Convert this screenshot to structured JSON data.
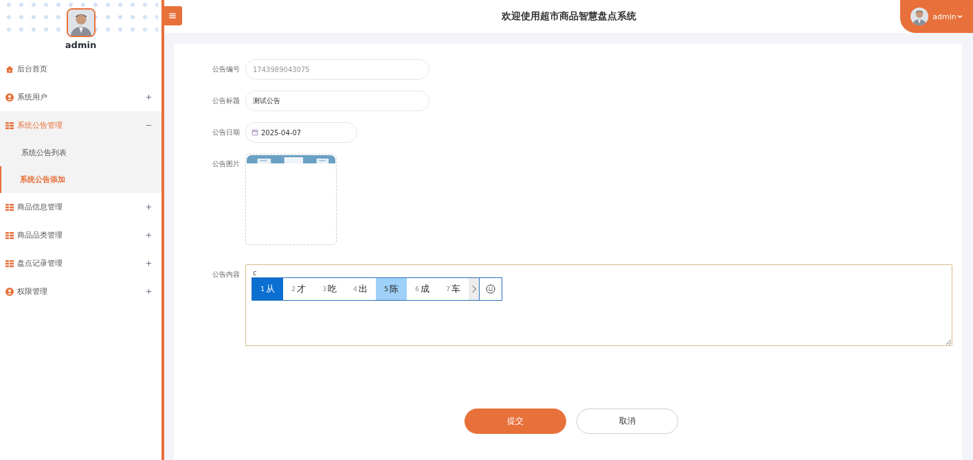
{
  "sidebar": {
    "user": {
      "name": "admin"
    },
    "items": [
      {
        "label": "后台首页",
        "kind": "home",
        "expanded": false,
        "has_toggle": false
      },
      {
        "label": "系统用户",
        "kind": "user",
        "expanded": false,
        "has_toggle": true
      },
      {
        "label": "系统公告管理",
        "kind": "group",
        "expanded": true,
        "has_toggle": true,
        "children": [
          {
            "label": "系统公告列表",
            "selected": false
          },
          {
            "label": "系统公告添加",
            "selected": true
          }
        ]
      },
      {
        "label": "商品信息管理",
        "kind": "group",
        "expanded": false,
        "has_toggle": true
      },
      {
        "label": "商品品类管理",
        "kind": "group",
        "expanded": false,
        "has_toggle": true
      },
      {
        "label": "盘点记录管理",
        "kind": "group",
        "expanded": false,
        "has_toggle": true
      },
      {
        "label": "权限管理",
        "kind": "user",
        "expanded": false,
        "has_toggle": true
      }
    ]
  },
  "header": {
    "title": "欢迎使用超市商品智慧盘点系统",
    "user": "admin"
  },
  "form": {
    "fields": [
      {
        "label": "公告编号",
        "kind": "text",
        "value": "1743989043075",
        "disabled": true
      },
      {
        "label": "公告标题",
        "kind": "text",
        "value": "测试公告",
        "disabled": false
      },
      {
        "label": "公告日期",
        "kind": "date",
        "value": "2025-04-07"
      },
      {
        "label": "公告图片"
      },
      {
        "label": "公告内容",
        "kind": "textarea",
        "value": "c"
      }
    ],
    "buttons": [
      {
        "label": "提交",
        "kind": "primary"
      },
      {
        "label": "取消",
        "kind": "secondary"
      }
    ]
  },
  "ime": {
    "candidates": [
      {
        "number": "1",
        "text": "从",
        "selected": true,
        "hovered": false
      },
      {
        "number": "2",
        "text": "才",
        "selected": false,
        "hovered": false
      },
      {
        "number": "3",
        "text": "吃",
        "selected": false,
        "hovered": false
      },
      {
        "number": "4",
        "text": "出",
        "selected": false,
        "hovered": false
      },
      {
        "number": "5",
        "text": "陈",
        "selected": false,
        "hovered": true
      },
      {
        "number": "6",
        "text": "成",
        "selected": false,
        "hovered": false
      },
      {
        "number": "7",
        "text": "车",
        "selected": false,
        "hovered": false
      }
    ]
  }
}
